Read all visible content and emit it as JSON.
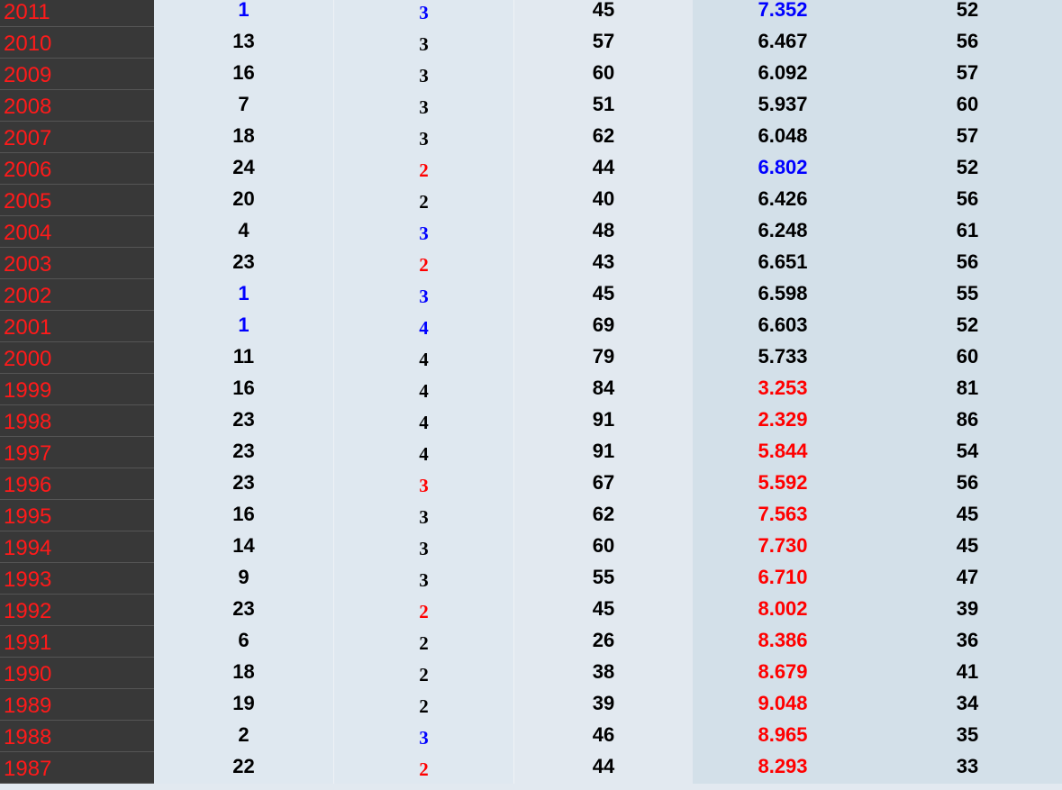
{
  "table": {
    "rows": [
      {
        "year": "2011",
        "c1": "1",
        "c2": "3",
        "c3": "45",
        "c4": "7.352",
        "c5": "52",
        "c1_color": "blue",
        "c2_color": "blue",
        "c4_color": "blue"
      },
      {
        "year": "2010",
        "c1": "13",
        "c2": "3",
        "c3": "57",
        "c4": "6.467",
        "c5": "56"
      },
      {
        "year": "2009",
        "c1": "16",
        "c2": "3",
        "c3": "60",
        "c4": "6.092",
        "c5": "57"
      },
      {
        "year": "2008",
        "c1": "7",
        "c2": "3",
        "c3": "51",
        "c4": "5.937",
        "c5": "60"
      },
      {
        "year": "2007",
        "c1": "18",
        "c2": "3",
        "c3": "62",
        "c4": "6.048",
        "c5": "57"
      },
      {
        "year": "2006",
        "c1": "24",
        "c2": "2",
        "c3": "44",
        "c4": "6.802",
        "c5": "52",
        "c2_color": "red",
        "c4_color": "blue"
      },
      {
        "year": "2005",
        "c1": "20",
        "c2": "2",
        "c3": "40",
        "c4": "6.426",
        "c5": "56"
      },
      {
        "year": "2004",
        "c1": "4",
        "c2": "3",
        "c3": "48",
        "c4": "6.248",
        "c5": "61",
        "c2_color": "blue"
      },
      {
        "year": "2003",
        "c1": "23",
        "c2": "2",
        "c3": "43",
        "c4": "6.651",
        "c5": "56",
        "c2_color": "red"
      },
      {
        "year": "2002",
        "c1": "1",
        "c2": "3",
        "c3": "45",
        "c4": "6.598",
        "c5": "55",
        "c1_color": "blue",
        "c2_color": "blue"
      },
      {
        "year": "2001",
        "c1": "1",
        "c2": "4",
        "c3": "69",
        "c4": "6.603",
        "c5": "52",
        "c1_color": "blue",
        "c2_color": "blue"
      },
      {
        "year": "2000",
        "c1": "11",
        "c2": "4",
        "c3": "79",
        "c4": "5.733",
        "c5": "60"
      },
      {
        "year": "1999",
        "c1": "16",
        "c2": "4",
        "c3": "84",
        "c4": "3.253",
        "c5": "81",
        "c4_color": "red"
      },
      {
        "year": "1998",
        "c1": "23",
        "c2": "4",
        "c3": "91",
        "c4": "2.329",
        "c5": "86",
        "c4_color": "red"
      },
      {
        "year": "1997",
        "c1": "23",
        "c2": "4",
        "c3": "91",
        "c4": "5.844",
        "c5": "54",
        "c4_color": "red"
      },
      {
        "year": "1996",
        "c1": "23",
        "c2": "3",
        "c3": "67",
        "c4": "5.592",
        "c5": "56",
        "c2_color": "red",
        "c4_color": "red"
      },
      {
        "year": "1995",
        "c1": "16",
        "c2": "3",
        "c3": "62",
        "c4": "7.563",
        "c5": "45",
        "c4_color": "red"
      },
      {
        "year": "1994",
        "c1": "14",
        "c2": "3",
        "c3": "60",
        "c4": "7.730",
        "c5": "45",
        "c4_color": "red"
      },
      {
        "year": "1993",
        "c1": "9",
        "c2": "3",
        "c3": "55",
        "c4": "6.710",
        "c5": "47",
        "c4_color": "red"
      },
      {
        "year": "1992",
        "c1": "23",
        "c2": "2",
        "c3": "45",
        "c4": "8.002",
        "c5": "39",
        "c2_color": "red",
        "c4_color": "red"
      },
      {
        "year": "1991",
        "c1": "6",
        "c2": "2",
        "c3": "26",
        "c4": "8.386",
        "c5": "36",
        "c4_color": "red"
      },
      {
        "year": "1990",
        "c1": "18",
        "c2": "2",
        "c3": "38",
        "c4": "8.679",
        "c5": "41",
        "c4_color": "red"
      },
      {
        "year": "1989",
        "c1": "19",
        "c2": "2",
        "c3": "39",
        "c4": "9.048",
        "c5": "34",
        "c4_color": "red"
      },
      {
        "year": "1988",
        "c1": "2",
        "c2": "3",
        "c3": "46",
        "c4": "8.965",
        "c5": "35",
        "c2_color": "blue",
        "c4_color": "red"
      },
      {
        "year": "1987",
        "c1": "22",
        "c2": "2",
        "c3": "44",
        "c4": "8.293",
        "c5": "33",
        "c2_color": "red",
        "c4_color": "red"
      }
    ],
    "colors": {
      "year_bg": "#383838",
      "year_text": "#ff1a1a",
      "blue": "#0000ff",
      "red": "#ff0000",
      "cell_bg": "#dfe8f0",
      "shaded_bg": "#d3e0e9"
    }
  }
}
